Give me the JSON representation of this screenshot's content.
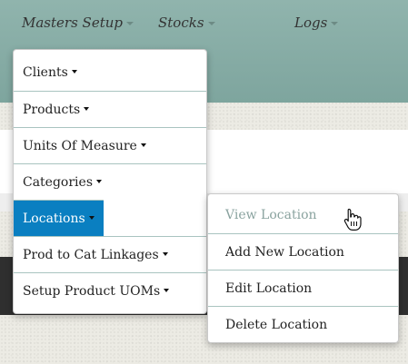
{
  "navbar": {
    "items": [
      {
        "label": "Masters Setup"
      },
      {
        "label": "Stocks"
      },
      {
        "label": "Logs"
      }
    ]
  },
  "masters_menu": {
    "items": [
      {
        "label": "Clients"
      },
      {
        "label": "Products"
      },
      {
        "label": "Units Of Measure"
      },
      {
        "label": "Categories"
      },
      {
        "label": "Locations",
        "active": true
      },
      {
        "label": "Prod to Cat Linkages"
      },
      {
        "label": "Setup Product UOMs"
      }
    ]
  },
  "locations_submenu": {
    "items": [
      {
        "label": "View Location",
        "hover": true
      },
      {
        "label": "Add New Location"
      },
      {
        "label": "Edit Location"
      },
      {
        "label": "Delete Location"
      }
    ]
  },
  "colors": {
    "navbar": "#8fb3ac",
    "active_item": "#0a7fc1",
    "divider": "#a9c4c0",
    "hover_text": "#8aa39f",
    "dark_band": "#2f2f2f"
  },
  "icons": {
    "caret": "caret-down-icon",
    "cursor": "hand-pointer-icon"
  }
}
